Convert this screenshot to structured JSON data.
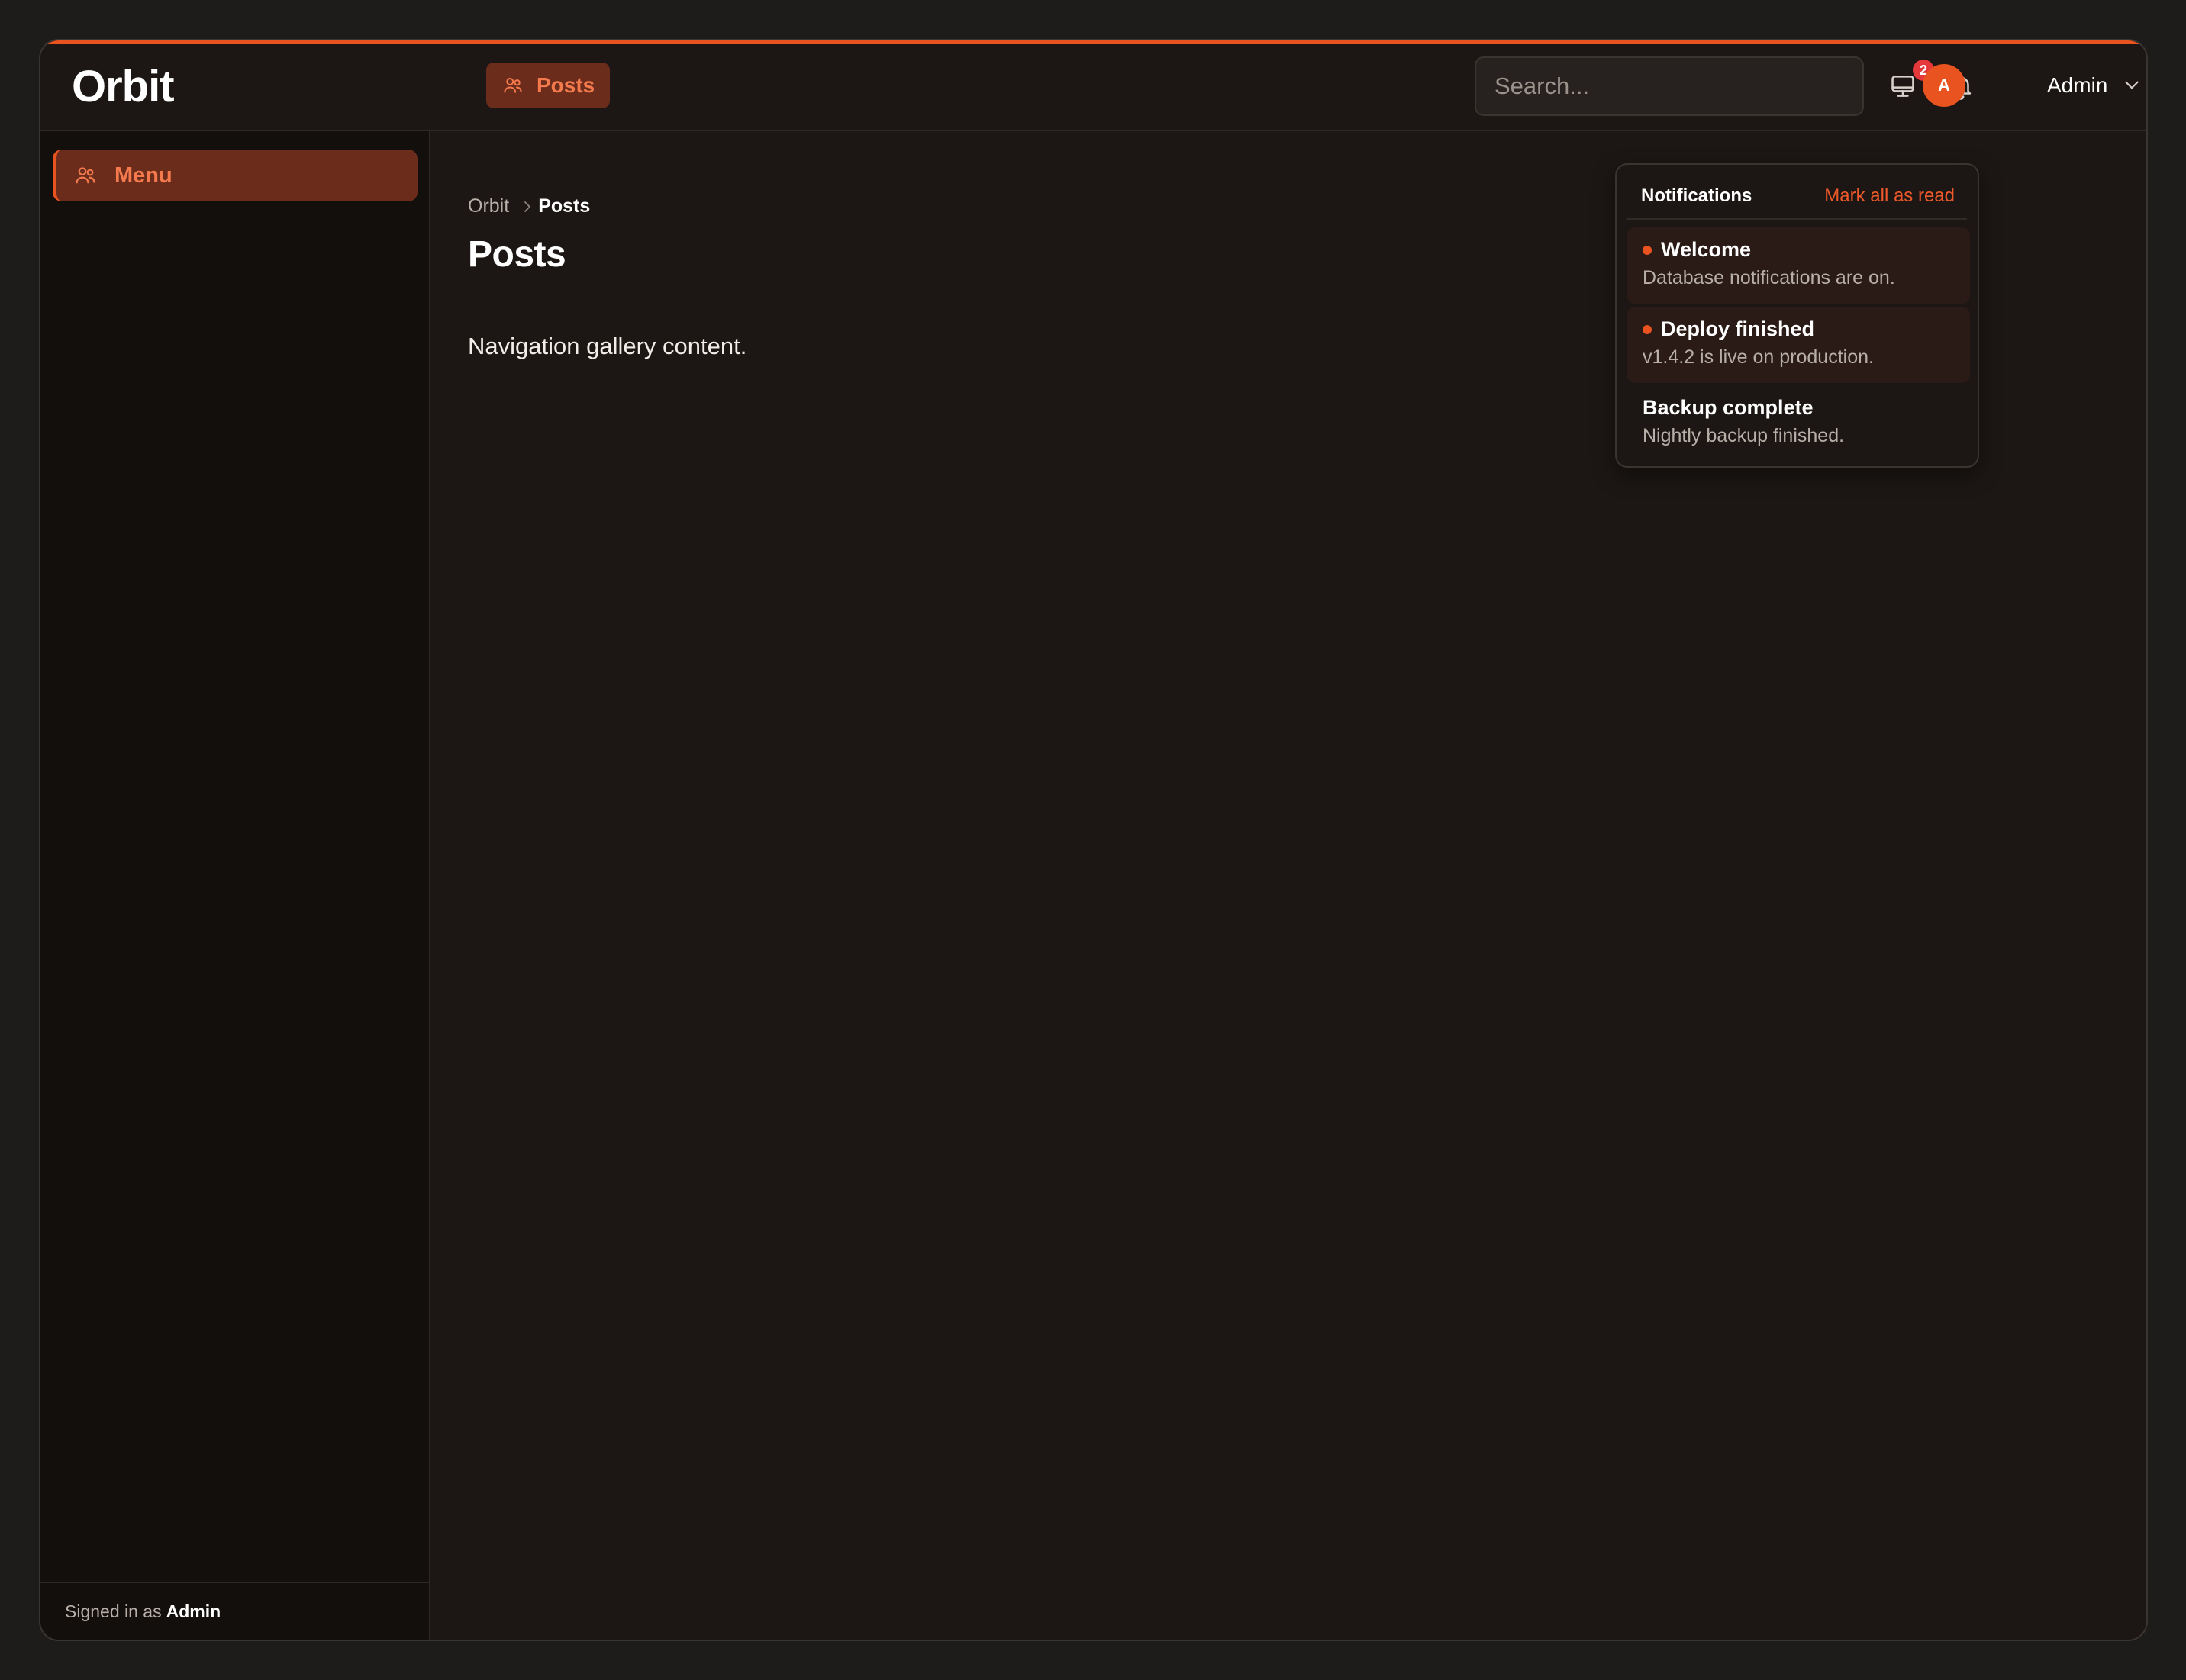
{
  "app": {
    "brand": "Orbit",
    "accent_color": "#e8531f"
  },
  "sidebar": {
    "items": [
      {
        "label": "Menu",
        "icon": "users-icon",
        "active": true
      }
    ],
    "footer": {
      "prefix": "Signed in as",
      "user": "Admin"
    }
  },
  "topbar": {
    "tabs": [
      {
        "label": "Posts",
        "icon": "users-icon",
        "active": true
      }
    ],
    "search": {
      "placeholder": "Search...",
      "value": ""
    },
    "notifications_count": "2",
    "user": {
      "initial": "A",
      "name": "Admin"
    }
  },
  "main": {
    "breadcrumb": {
      "root": "Orbit",
      "current": "Posts"
    },
    "title": "Posts",
    "content": "Navigation gallery content."
  },
  "notifications": {
    "title": "Notifications",
    "mark_all_label": "Mark all as read",
    "items": [
      {
        "title": "Welcome",
        "body": "Database notifications are on.",
        "unread": true
      },
      {
        "title": "Deploy finished",
        "body": "v1.4.2 is live on production.",
        "unread": true
      },
      {
        "title": "Backup complete",
        "body": "Nightly backup finished.",
        "unread": false
      }
    ]
  }
}
